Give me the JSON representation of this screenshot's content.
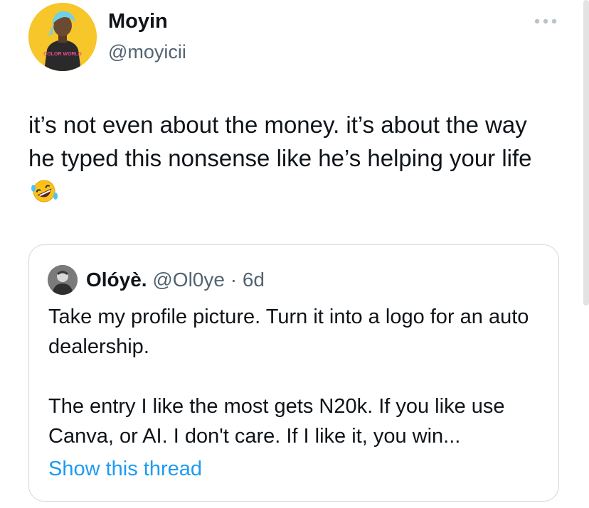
{
  "author": {
    "name": "Moyin",
    "handle": "@moyicii",
    "avatar_shirt_text": "COLOR WORLD"
  },
  "tweet": {
    "text": "it’s not even about the money. it’s about the way he typed this nonsense like he’s helping your life",
    "emoji": "rolling-on-the-floor-laughing"
  },
  "quote": {
    "name": "Olóyè.",
    "handle": "@Ol0ye",
    "separator": "·",
    "age": "6d",
    "paragraph1": "Take my profile picture. Turn it into a logo for an auto dealership.",
    "paragraph2": "The entry I like the most gets N20k. If you like use Canva, or AI. I don't care. If I like it, you win...",
    "show_thread": "Show this thread"
  },
  "icons": {
    "more": "more-horizontal-icon",
    "emoji": "rofl-emoji-icon"
  },
  "colors": {
    "text": "#0f1419",
    "secondary": "#536471",
    "link": "#1d9bf0",
    "border": "#cfd9de",
    "avatar_bg": "#f6c62a"
  }
}
